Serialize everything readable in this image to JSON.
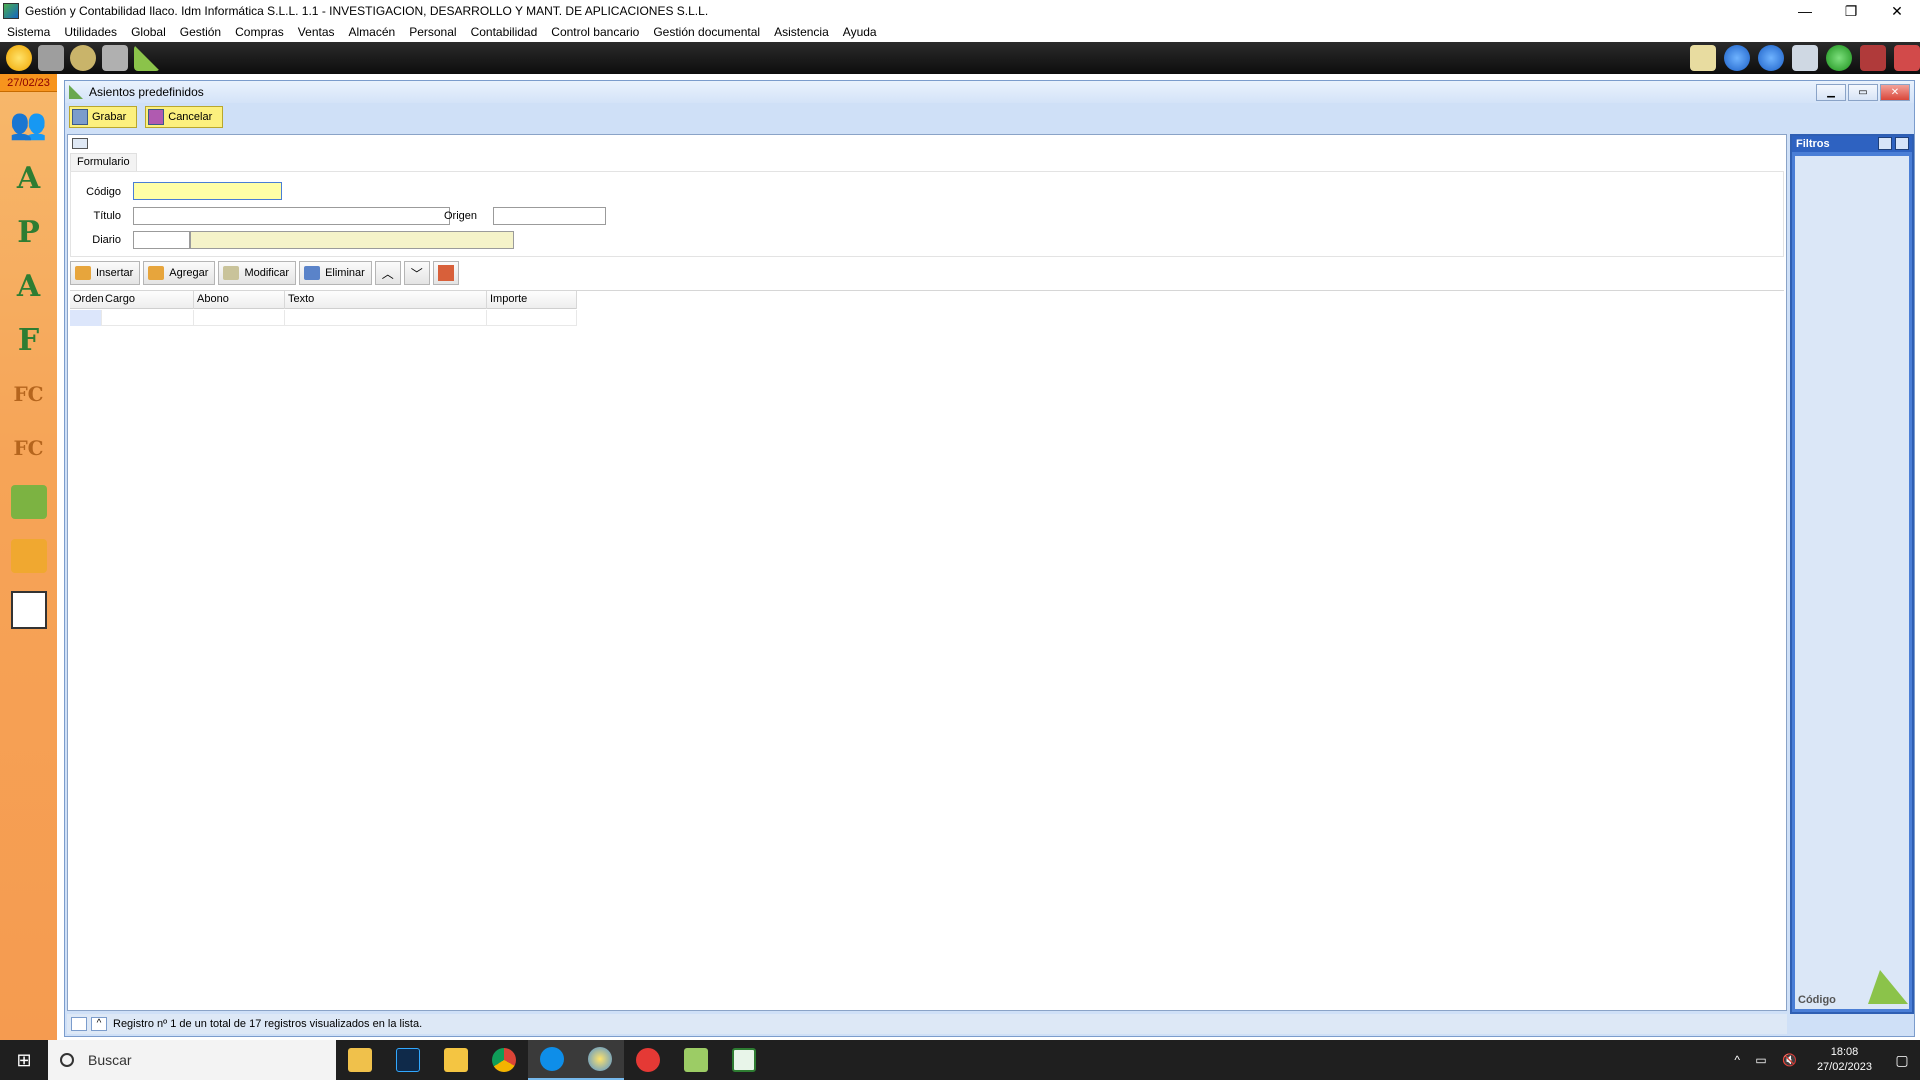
{
  "window": {
    "title": "Gestión y Contabilidad Ilaco. Idm Informática S.L.L. 1.1 - INVESTIGACION, DESARROLLO Y MANT. DE APLICACIONES S.L.L."
  },
  "menu": [
    "Sistema",
    "Utilidades",
    "Global",
    "Gestión",
    "Compras",
    "Ventas",
    "Almacén",
    "Personal",
    "Contabilidad",
    "Control bancario",
    "Gestión documental",
    "Asistencia",
    "Ayuda"
  ],
  "sidebar": {
    "date": "27/02/23",
    "icons": [
      "clients-icon",
      "a-box-icon",
      "p-icon",
      "a-icon",
      "f-icon",
      "fc-icon",
      "fc2-icon",
      "green-bag-icon",
      "orange-bag-icon",
      "ledger-icon"
    ],
    "letters": [
      "",
      "A",
      "P",
      "A",
      "F",
      "FC",
      "FC",
      "",
      "",
      ""
    ]
  },
  "subwindow": {
    "title": "Asientos predefinidos",
    "save_label": "Grabar",
    "cancel_label": "Cancelar",
    "tab_label": "Formulario"
  },
  "form": {
    "codigo_label": "Código",
    "titulo_label": "Título",
    "origen_label": "Origen",
    "diario_label": "Diario",
    "codigo_value": "",
    "titulo_value": "",
    "origen_value": "",
    "diario_value": ""
  },
  "grid_toolbar": {
    "insert_label": "Insertar",
    "add_label": "Agregar",
    "modify_label": "Modificar",
    "delete_label": "Eliminar"
  },
  "grid": {
    "columns": [
      "Orden",
      "Cargo",
      "Abono",
      "Texto",
      "Importe"
    ]
  },
  "status": {
    "text": "Registro nº 1 de un total de 17 registros visualizados en la lista."
  },
  "filters": {
    "title": "Filtros",
    "field_label": "Código"
  },
  "taskbar": {
    "search_placeholder": "Buscar",
    "time": "18:08",
    "date": "27/02/2023"
  }
}
